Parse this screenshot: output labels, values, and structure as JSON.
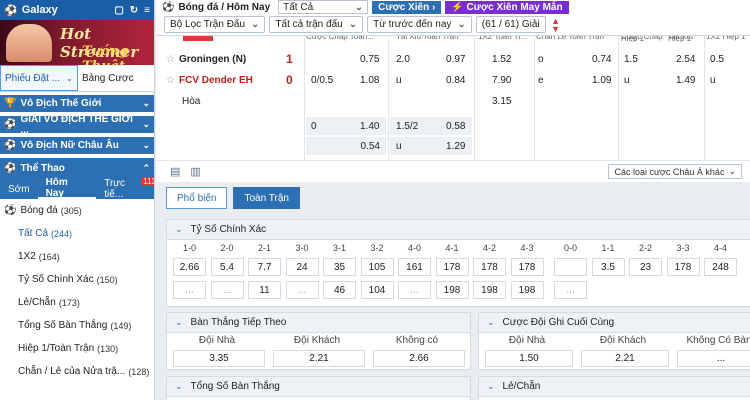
{
  "brand": {
    "name": "Galaxy"
  },
  "banner": {
    "line1": "Hot Streamer",
    "line2": "Tướng Thuật"
  },
  "modes": {
    "phieu": "Phiếu Đặt ...",
    "bang": "Bảng Cược"
  },
  "sections": [
    "Vô Địch Thế Giới",
    "GIẢI VÔ ĐỊCH THẾ GIỚI ...",
    "Vô Địch Nữ Châu Âu",
    "Thể Thao"
  ],
  "subtabs": {
    "som": "Sớm",
    "homnay": "Hôm Nay",
    "tructiep": "Trực tiế...",
    "badge": "113"
  },
  "sportlist": {
    "head": "Bóng đá",
    "headcount": "(305)",
    "items": [
      {
        "label": "Tất Cả",
        "count": "(244)"
      },
      {
        "label": "1X2",
        "count": "(164)"
      },
      {
        "label": "Tỷ Số Chính Xác",
        "count": "(150)"
      },
      {
        "label": "Lẻ/Chẵn",
        "count": "(173)"
      },
      {
        "label": "Tổng Số Bàn Thắng",
        "count": "(149)"
      },
      {
        "label": "Hiệp 1/Toàn Trận",
        "count": "(130)"
      },
      {
        "label": "Chẵn / Lẻ của Nửa trậ...",
        "count": "(128)"
      }
    ]
  },
  "topbar": {
    "title": "Bóng đá / Hôm Nay",
    "select": "Tất Cả",
    "btn_xien": "Cược Xiên",
    "btn_xien_mm": "Cược Xiên May Mắn"
  },
  "filters": {
    "f1": "Bộ Lọc Trận Đấu",
    "f2": "Tất cả trận đấu",
    "f3": "Từ trước đến nay",
    "f4": "(61 / 61) Giải"
  },
  "columns": [
    "Cược Chấp Toàn...",
    "Tài Xỉu Toàn Trận",
    "1X2 Toàn Tr...",
    "Chẵn Lẻ Toàn Trận",
    "Cược Chấp Hiệp 1",
    "Tài Xỉu Hiệp 1",
    "1X2 Hiệp 1"
  ],
  "match": {
    "home": "Groningen (N)",
    "away": "FCV Dender EH",
    "draw": "Hòa",
    "home_score": "1",
    "away_score": "0"
  },
  "odds": {
    "r1": [
      "0.75",
      "2.0",
      "0.97",
      "1.52",
      "o",
      "0.74",
      "1.5",
      "2.54",
      "0.5"
    ],
    "r2": [
      "0/0.5",
      "1.08",
      "u",
      "0.84",
      "7.90",
      "e",
      "1.09",
      "u",
      "1.49",
      "u"
    ],
    "r3": [
      "3.15"
    ],
    "r4": [
      "0",
      "1.40",
      "1.5/2",
      "0.58"
    ],
    "r5": [
      "0.54",
      "u",
      "1.29"
    ]
  },
  "actions": {
    "dropdown": "Các loại cược Châu Á khác"
  },
  "tabs": {
    "phobien": "Phổ biến",
    "toantran": "Toàn Trận"
  },
  "correct_score": {
    "title": "Tỷ Số Chính Xác",
    "headers": [
      "1-0",
      "2-0",
      "2-1",
      "3-0",
      "3-1",
      "3-2",
      "4-0",
      "4-1",
      "4-2",
      "4-3",
      "0-0",
      "1-1",
      "2-2",
      "3-3",
      "4-4"
    ],
    "row1": [
      "2.66",
      "5.4",
      "7.7",
      "24",
      "35",
      "105",
      "161",
      "178",
      "178",
      "178",
      "",
      "3.5",
      "23",
      "178",
      "248"
    ],
    "row2": [
      "...",
      "...",
      "11",
      "...",
      "46",
      "104",
      "...",
      "198",
      "198",
      "198",
      "...",
      "",
      "",
      "",
      ""
    ]
  },
  "nextgoal": {
    "title": "Bàn Thắng Tiếp Theo",
    "h": [
      "Đội Nhà",
      "Đội Khách",
      "Không có"
    ],
    "v": [
      "3.35",
      "2.21",
      "2.66"
    ]
  },
  "lastgoal": {
    "title": "Cược Đội Ghi Cuối Cùng",
    "h": [
      "Đội Nhà",
      "Đội Khách",
      "Không Có Bàn"
    ],
    "v": [
      "1.50",
      "2.21",
      "..."
    ]
  },
  "totalgoals": {
    "title": "Tổng Số Bàn Thắng"
  },
  "oddeven": {
    "title": "Lẻ/Chẵn"
  }
}
